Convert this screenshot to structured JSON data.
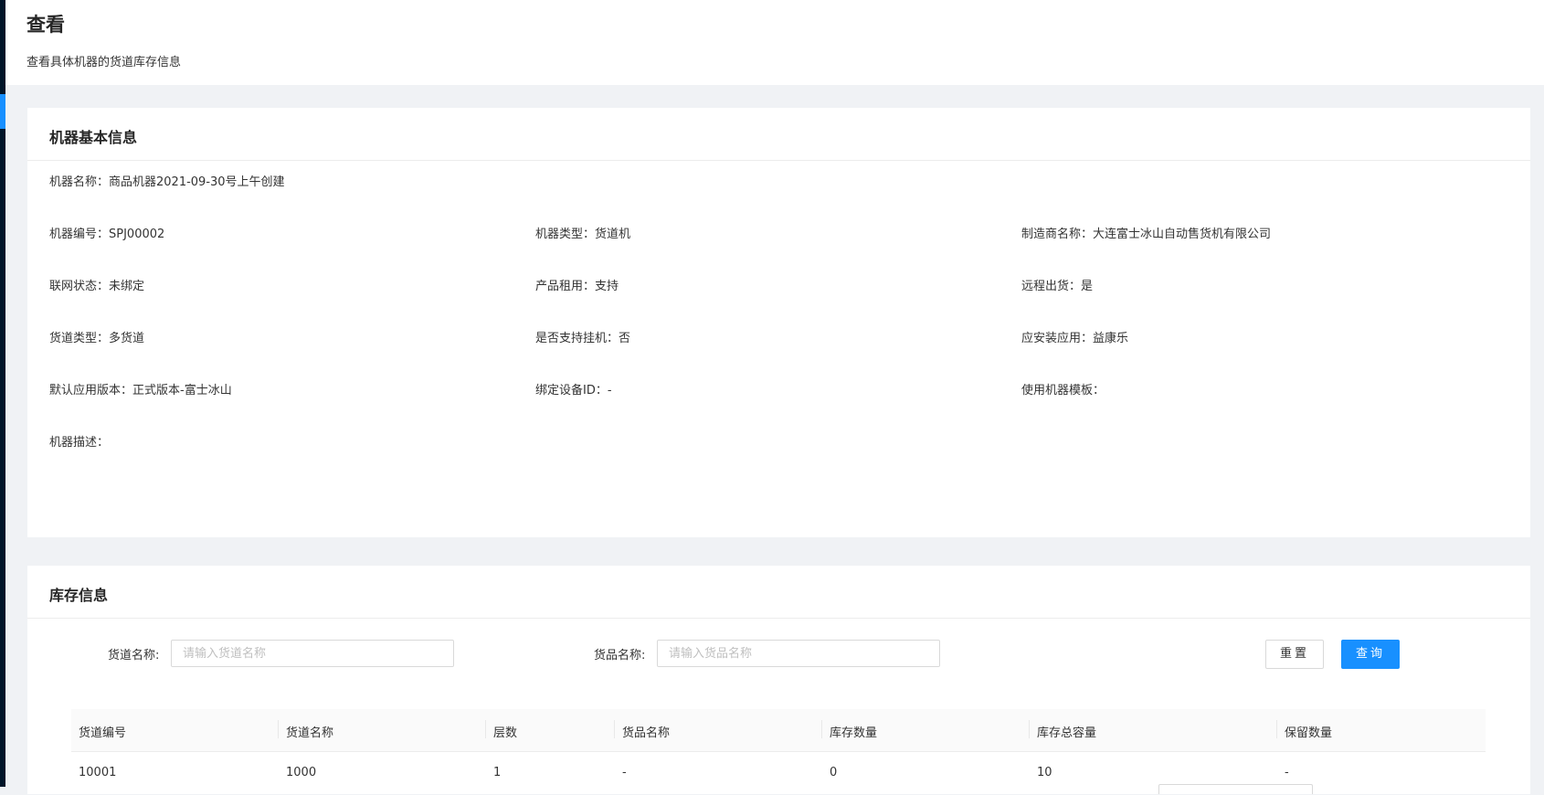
{
  "header": {
    "title": "查看",
    "description": "查看具体机器的货道库存信息"
  },
  "basic_info": {
    "title": "机器基本信息",
    "machine_name": "机器名称：商品机器2021-09-30号上午创建",
    "rows": [
      [
        "机器编号：SPJ00002",
        "机器类型：货道机",
        "制造商名称：大连富士冰山自动售货机有限公司"
      ],
      [
        "联网状态：未绑定",
        "产品租用：支持",
        "远程出货：是"
      ],
      [
        "货道类型：多货道",
        "是否支持挂机：否",
        "应安装应用：益康乐"
      ],
      [
        "默认应用版本：正式版本-富士冰山",
        "绑定设备ID：-",
        "使用机器模板："
      ]
    ],
    "description": "机器描述："
  },
  "stock": {
    "title": "库存信息",
    "filters": {
      "channel_label": "货道名称:",
      "channel_placeholder": "请输入货道名称",
      "product_label": "货品名称:",
      "product_placeholder": "请输入货品名称"
    },
    "reset_label": "重置",
    "query_label": "查询",
    "columns": [
      "货道编号",
      "货道名称",
      "层数",
      "货品名称",
      "库存数量",
      "库存总容量",
      "保留数量"
    ],
    "rows": [
      [
        "10001",
        "1000",
        "1",
        "-",
        "0",
        "10",
        "-"
      ]
    ]
  },
  "colors": {
    "primary": "#1890ff",
    "sidebar": "#001529",
    "background": "#f0f2f5"
  }
}
